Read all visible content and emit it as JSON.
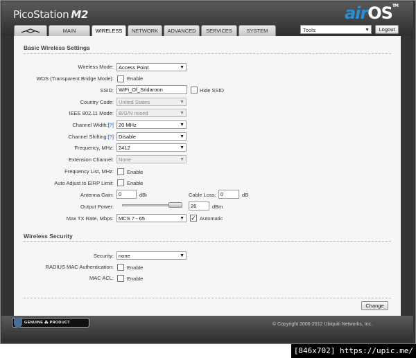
{
  "brand": {
    "name": "PicoStation",
    "model": "M2",
    "os_air": "air",
    "os_os": "OS",
    "tm": "TM"
  },
  "tabs": [
    {
      "label": ""
    },
    {
      "label": "MAIN"
    },
    {
      "label": "WIRELESS"
    },
    {
      "label": "NETWORK"
    },
    {
      "label": "ADVANCED"
    },
    {
      "label": "SERVICES"
    },
    {
      "label": "SYSTEM"
    }
  ],
  "tools": {
    "value": "Tools:",
    "logout": "Logout"
  },
  "sections": {
    "basic": "Basic Wireless Settings",
    "security": "Wireless Security"
  },
  "form": {
    "wireless_mode": {
      "label": "Wireless Mode:",
      "value": "Access Point"
    },
    "wds": {
      "label": "WDS (Transparent Bridge Mode):",
      "option": "Enable",
      "checked": false
    },
    "ssid": {
      "label": "SSID:",
      "value": "WiFi_Of_Sridaroon",
      "hide_label": "Hide SSID",
      "hide_checked": false
    },
    "country": {
      "label": "Country Code:",
      "value": "United States"
    },
    "ieee": {
      "label": "IEEE 802.11 Mode:",
      "value": "B/G/N mixed"
    },
    "channel_width": {
      "label": "Channel Width:",
      "help": "[?]",
      "value": "20 MHz"
    },
    "channel_shifting": {
      "label": "Channel Shifting:",
      "help": "[?]",
      "value": "Disable"
    },
    "frequency": {
      "label": "Frequency, MHz:",
      "value": "2412"
    },
    "extension": {
      "label": "Extension Channel:",
      "value": "None"
    },
    "frequency_list": {
      "label": "Frequency List, MHz:",
      "option": "Enable",
      "checked": false
    },
    "eirp": {
      "label": "Auto Adjust to EIRP Limit:",
      "option": "Enable",
      "checked": false
    },
    "antenna_gain": {
      "label": "Antenna Gain:",
      "value": "0",
      "unit": "dBi"
    },
    "cable_loss": {
      "label": "Cable Loss:",
      "value": "0",
      "unit": "dB"
    },
    "output_power": {
      "label": "Output Power:",
      "value": "26",
      "unit": "dBm",
      "level": 0.97
    },
    "max_tx": {
      "label": "Max TX Rate, Mbps:",
      "value": "MCS 7 - 65",
      "auto_label": "Automatic",
      "auto_checked": true
    },
    "security": {
      "label": "Security:",
      "value": "none"
    },
    "radius_mac": {
      "label": "RADIUS MAC Authentication:",
      "option": "Enable",
      "checked": false
    },
    "mac_acl": {
      "label": "MAC ACL:",
      "option": "Enable",
      "checked": false
    }
  },
  "change_label": "Change",
  "footer": {
    "badge": "GENUINE  ⁂  PRODUCT",
    "copyright": "© Copyright 2006-2012 Ubiquiti Networks, Inc."
  },
  "watermark": "[846x702] https://upic.me/",
  "colors": {
    "accent": "#2a8fd4",
    "header": "#3c3c3c",
    "panel": "#f6f6f6"
  }
}
